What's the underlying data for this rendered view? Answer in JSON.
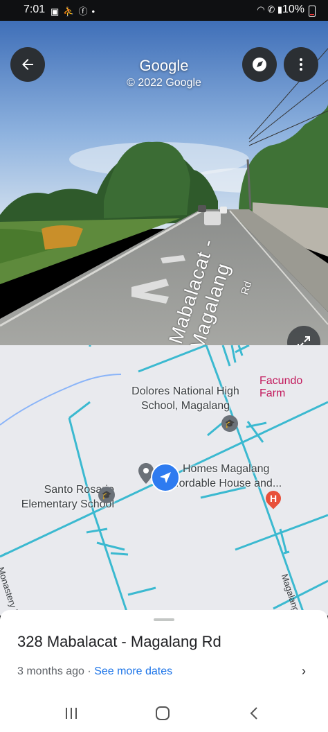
{
  "status_bar": {
    "time": "7:01",
    "notification_icons": [
      "gallery-icon",
      "runner-icon",
      "facebook-icon",
      "dot-icon"
    ],
    "battery": "10%",
    "right_icons": [
      "wifi-icon",
      "call-icon",
      "signal-icon"
    ]
  },
  "street_view": {
    "title": "Google",
    "copyright": "© 2022 Google",
    "road_name": "Mabalacat - Magalang",
    "road_suffix": "Rd"
  },
  "map": {
    "labels": {
      "school1_line1": "Dolores National High",
      "school1_line2": "School, Magalang",
      "farm": "Facundo Farm",
      "homes_line1": "Homes Magalang",
      "homes_line2": "ffordable House and...",
      "school2_line1": "Santo Rosario",
      "school2_line2": "Elementary School",
      "road_left": "Monastery Ro",
      "road_right": "Magalang"
    },
    "colors": {
      "road": "#3bb9d0",
      "water": "#8ab4f8",
      "background": "#e9eaee",
      "location": "#2e7bf0",
      "hospital": "#e8503a",
      "farm_label": "#c2185b"
    }
  },
  "bottom_sheet": {
    "address": "328 Mabalacat - Magalang Rd",
    "age": "3 months ago",
    "separator": "·",
    "see_more": "See more dates"
  }
}
